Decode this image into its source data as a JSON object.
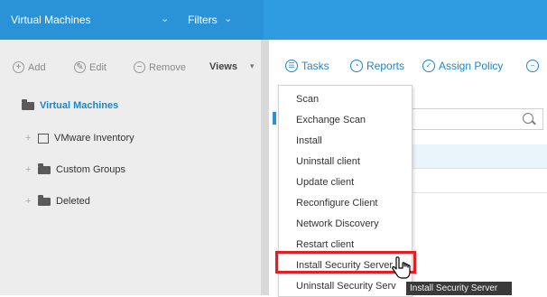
{
  "header": {
    "title": "Virtual Machines",
    "filters": "Filters",
    "title_chevron_icon": "chevron-down-icon",
    "filters_chevron_icon": "chevron-down-icon"
  },
  "left_toolbar": {
    "add": "Add",
    "add_symbol": "+",
    "edit": "Edit",
    "remove": "Remove",
    "remove_symbol": "−",
    "views": "Views",
    "views_chevron": "▾"
  },
  "tree": {
    "root": "Virtual Machines",
    "items": [
      {
        "label": "VMware Inventory",
        "expander": "+"
      },
      {
        "label": "Custom Groups",
        "expander": "+"
      },
      {
        "label": "Deleted",
        "expander": "+"
      }
    ]
  },
  "right_toolbar": {
    "tasks": "Tasks",
    "reports": "Reports",
    "assign_policy": "Assign Policy"
  },
  "tasks_menu": {
    "items": [
      "Scan",
      "Exchange Scan",
      "Install",
      "Uninstall client",
      "Update client",
      "Reconfigure Client",
      "Network Discovery",
      "Restart client",
      "Install Security Server",
      "Uninstall Security Serv"
    ],
    "highlighted_index": 8
  },
  "tooltip": "Install Security Server",
  "colors": {
    "header_blue": "#2f9be0",
    "link_blue": "#1a86cf",
    "highlight_red": "#e31e24"
  }
}
